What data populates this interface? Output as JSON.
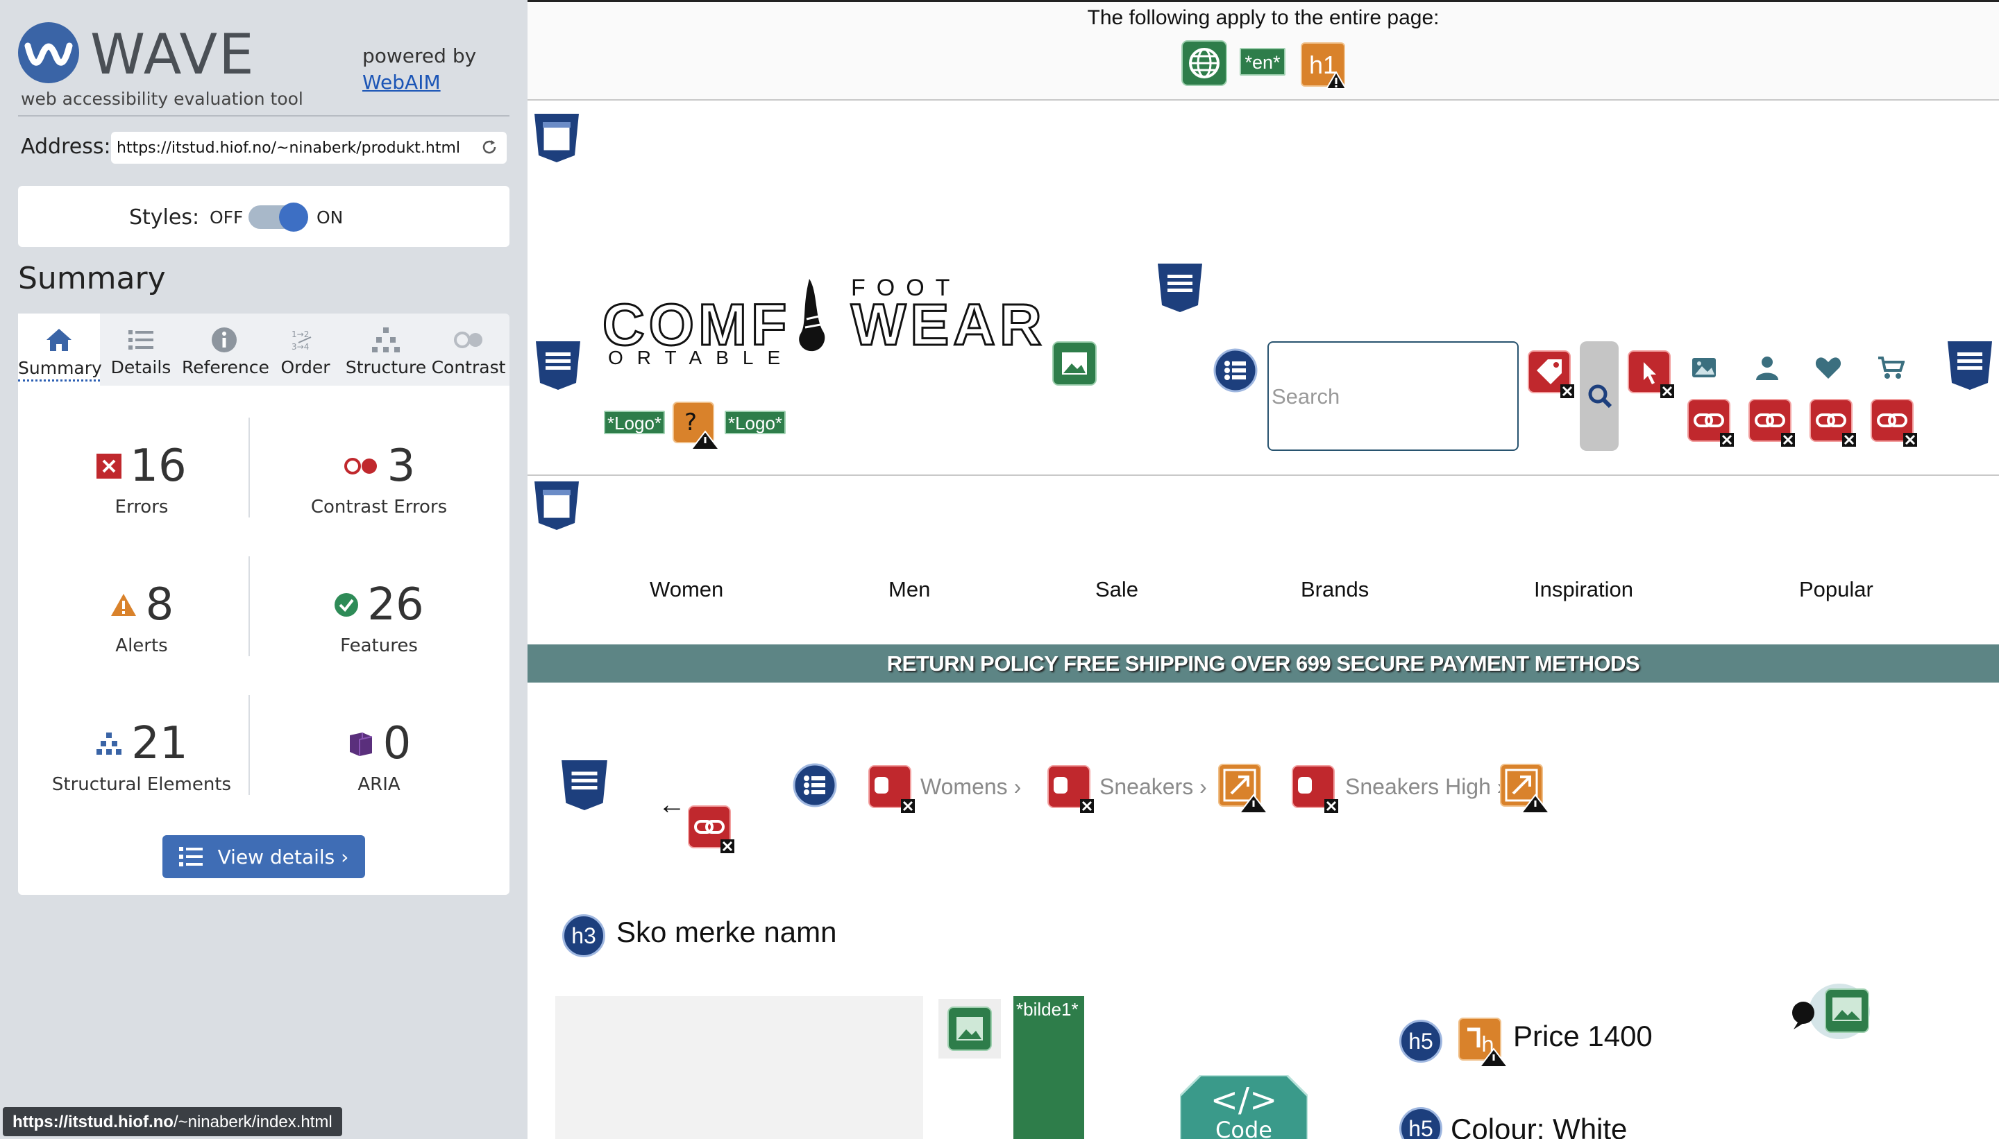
{
  "wave": {
    "title": "WAVE",
    "subtitle": "web accessibility evaluation tool",
    "powered_by": "powered by",
    "webaim": "WebAIM",
    "address_label": "Address:",
    "address_value": "https://itstud.hiof.no/~ninaberk/produkt.html",
    "styles_label": "Styles:",
    "styles_off": "OFF",
    "styles_on": "ON",
    "styles_enabled": true,
    "summary_heading": "Summary",
    "tabs": [
      {
        "label": "Summary",
        "icon": "home-icon",
        "active": true
      },
      {
        "label": "Details",
        "icon": "list-icon",
        "active": false
      },
      {
        "label": "Reference",
        "icon": "info-icon",
        "active": false
      },
      {
        "label": "Order",
        "icon": "order-icon",
        "active": false
      },
      {
        "label": "Structure",
        "icon": "structure-icon",
        "active": false
      },
      {
        "label": "Contrast",
        "icon": "contrast-icon",
        "active": false
      }
    ],
    "stats": {
      "errors": {
        "value": "16",
        "label": "Errors"
      },
      "contrast": {
        "value": "3",
        "label": "Contrast Errors"
      },
      "alerts": {
        "value": "8",
        "label": "Alerts"
      },
      "features": {
        "value": "26",
        "label": "Features"
      },
      "structural": {
        "value": "21",
        "label": "Structural Elements"
      },
      "aria": {
        "value": "0",
        "label": "ARIA"
      }
    },
    "view_details": "View details ›",
    "status_url_host": "https://itstud.hiof.no",
    "status_url_path": "/~ninaberk/index.html"
  },
  "page": {
    "apply_text": "The following apply to the entire page:",
    "lang_badge": "*en*",
    "h1_badge": "h1",
    "logo": {
      "comf": "COMF",
      "ortable": "ORTABLE",
      "foot": "FOOT",
      "wear": "WEAR",
      "alt_left": "*Logo*",
      "alt_right": "*Logo*"
    },
    "search_placeholder": "Search",
    "nav": [
      "Women",
      "Men",
      "Sale",
      "Brands",
      "Inspiration",
      "Popular"
    ],
    "banner": "RETURN POLICY FREE SHIPPING OVER 699 SECURE PAYMENT METHODS",
    "back_arrow": "←",
    "breadcrumbs": [
      "Womens",
      "Sneakers",
      "Sneakers High"
    ],
    "crumb_sep": "›",
    "product_heading": "Sko merke namn",
    "h3_badge": "h3",
    "h5_badge": "h5",
    "bilde_alt": "*bilde1*",
    "code_label": "Code",
    "price": "Price 1400",
    "colour": "Colour: White"
  },
  "colors": {
    "wave_blue": "#3a64a6",
    "error_red": "#c0282d",
    "alert_orange": "#d9822b",
    "feature_green": "#2e7d4a",
    "structure_navy": "#1d3f7d",
    "banner_teal": "#5d8585"
  }
}
